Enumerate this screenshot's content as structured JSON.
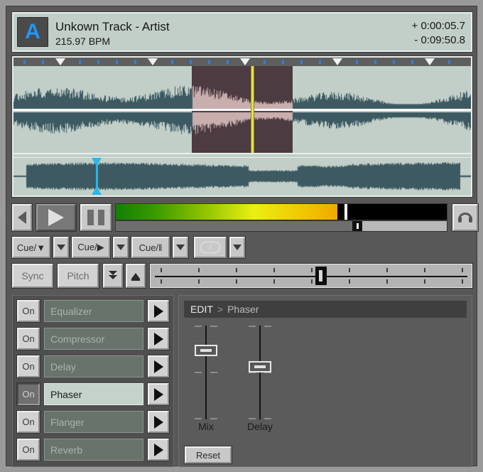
{
  "deck": {
    "letter": "A",
    "accent_color": "#2196f3"
  },
  "track_info": {
    "title": "Unkown Track - Artist",
    "bpm": "215.97 BPM",
    "time_elapsed": "+ 0:00:05.7",
    "time_remaining": "- 0:09:50.8"
  },
  "waveform": {
    "playhead_percent": 52,
    "loop_start_percent": 39,
    "loop_end_percent": 61,
    "loop_region_color": "#4d3b42",
    "waveform_color": "#3d5a63",
    "background_color": "#c2cfc8",
    "playhead_color": "#e8e23c",
    "beat_marker_color": "#2f80d8",
    "downbeat_marker_color": "#f2f2f2",
    "beat_tick_count": 20,
    "downbeat_positions": [
      2,
      7,
      12,
      17,
      22
    ],
    "overview": {
      "marker_percent": 18,
      "marker_color": "#29b6e8"
    }
  },
  "transport": {
    "prev_icon": "skip-previous-icon",
    "play_icon": "play-icon",
    "pause_icon": "pause-icon",
    "cue_monitor_icon": "headphones-icon",
    "vu": {
      "level_percent": 67,
      "peak_percent": 69
    },
    "position": {
      "value_percent": 73
    }
  },
  "cue_row": {
    "buttons": [
      {
        "label": "Cue/▼",
        "name": "cue-set-button"
      },
      {
        "label": "Cue/▶",
        "name": "cue-play-button"
      },
      {
        "label": "Cue/‖",
        "name": "cue-pause-button"
      }
    ],
    "dropdown_icon": "chevron-down-icon",
    "loop": {
      "label": "4",
      "name": "loop-button",
      "icon": "loop-icon"
    },
    "loop_dropdown_icon": "chevron-down-icon"
  },
  "pitch_row": {
    "sync_label": "Sync",
    "pitch_label": "Pitch",
    "nudge_down_icon": "double-arrow-down-icon",
    "nudge_up_icon": "arrow-up-bar-icon",
    "slider": {
      "value_percent": 53,
      "tick_count": 9
    }
  },
  "effects": {
    "on_label": "On",
    "go_icon": "arrow-right-icon",
    "rows": [
      {
        "name": "Equalizer",
        "on": false,
        "selected": false
      },
      {
        "name": "Compressor",
        "on": false,
        "selected": false
      },
      {
        "name": "Delay",
        "on": false,
        "selected": false
      },
      {
        "name": "Phaser",
        "on": true,
        "selected": true
      },
      {
        "name": "Flanger",
        "on": false,
        "selected": false
      },
      {
        "name": "Reverb",
        "on": false,
        "selected": false
      }
    ]
  },
  "edit_panel": {
    "header_prefix": "EDIT",
    "header_separator": ">",
    "header_target": "Phaser",
    "sliders": [
      {
        "label": "Mix",
        "value_percent": 78
      },
      {
        "label": "Delay",
        "value_percent": 60
      }
    ],
    "reset_label": "Reset"
  }
}
